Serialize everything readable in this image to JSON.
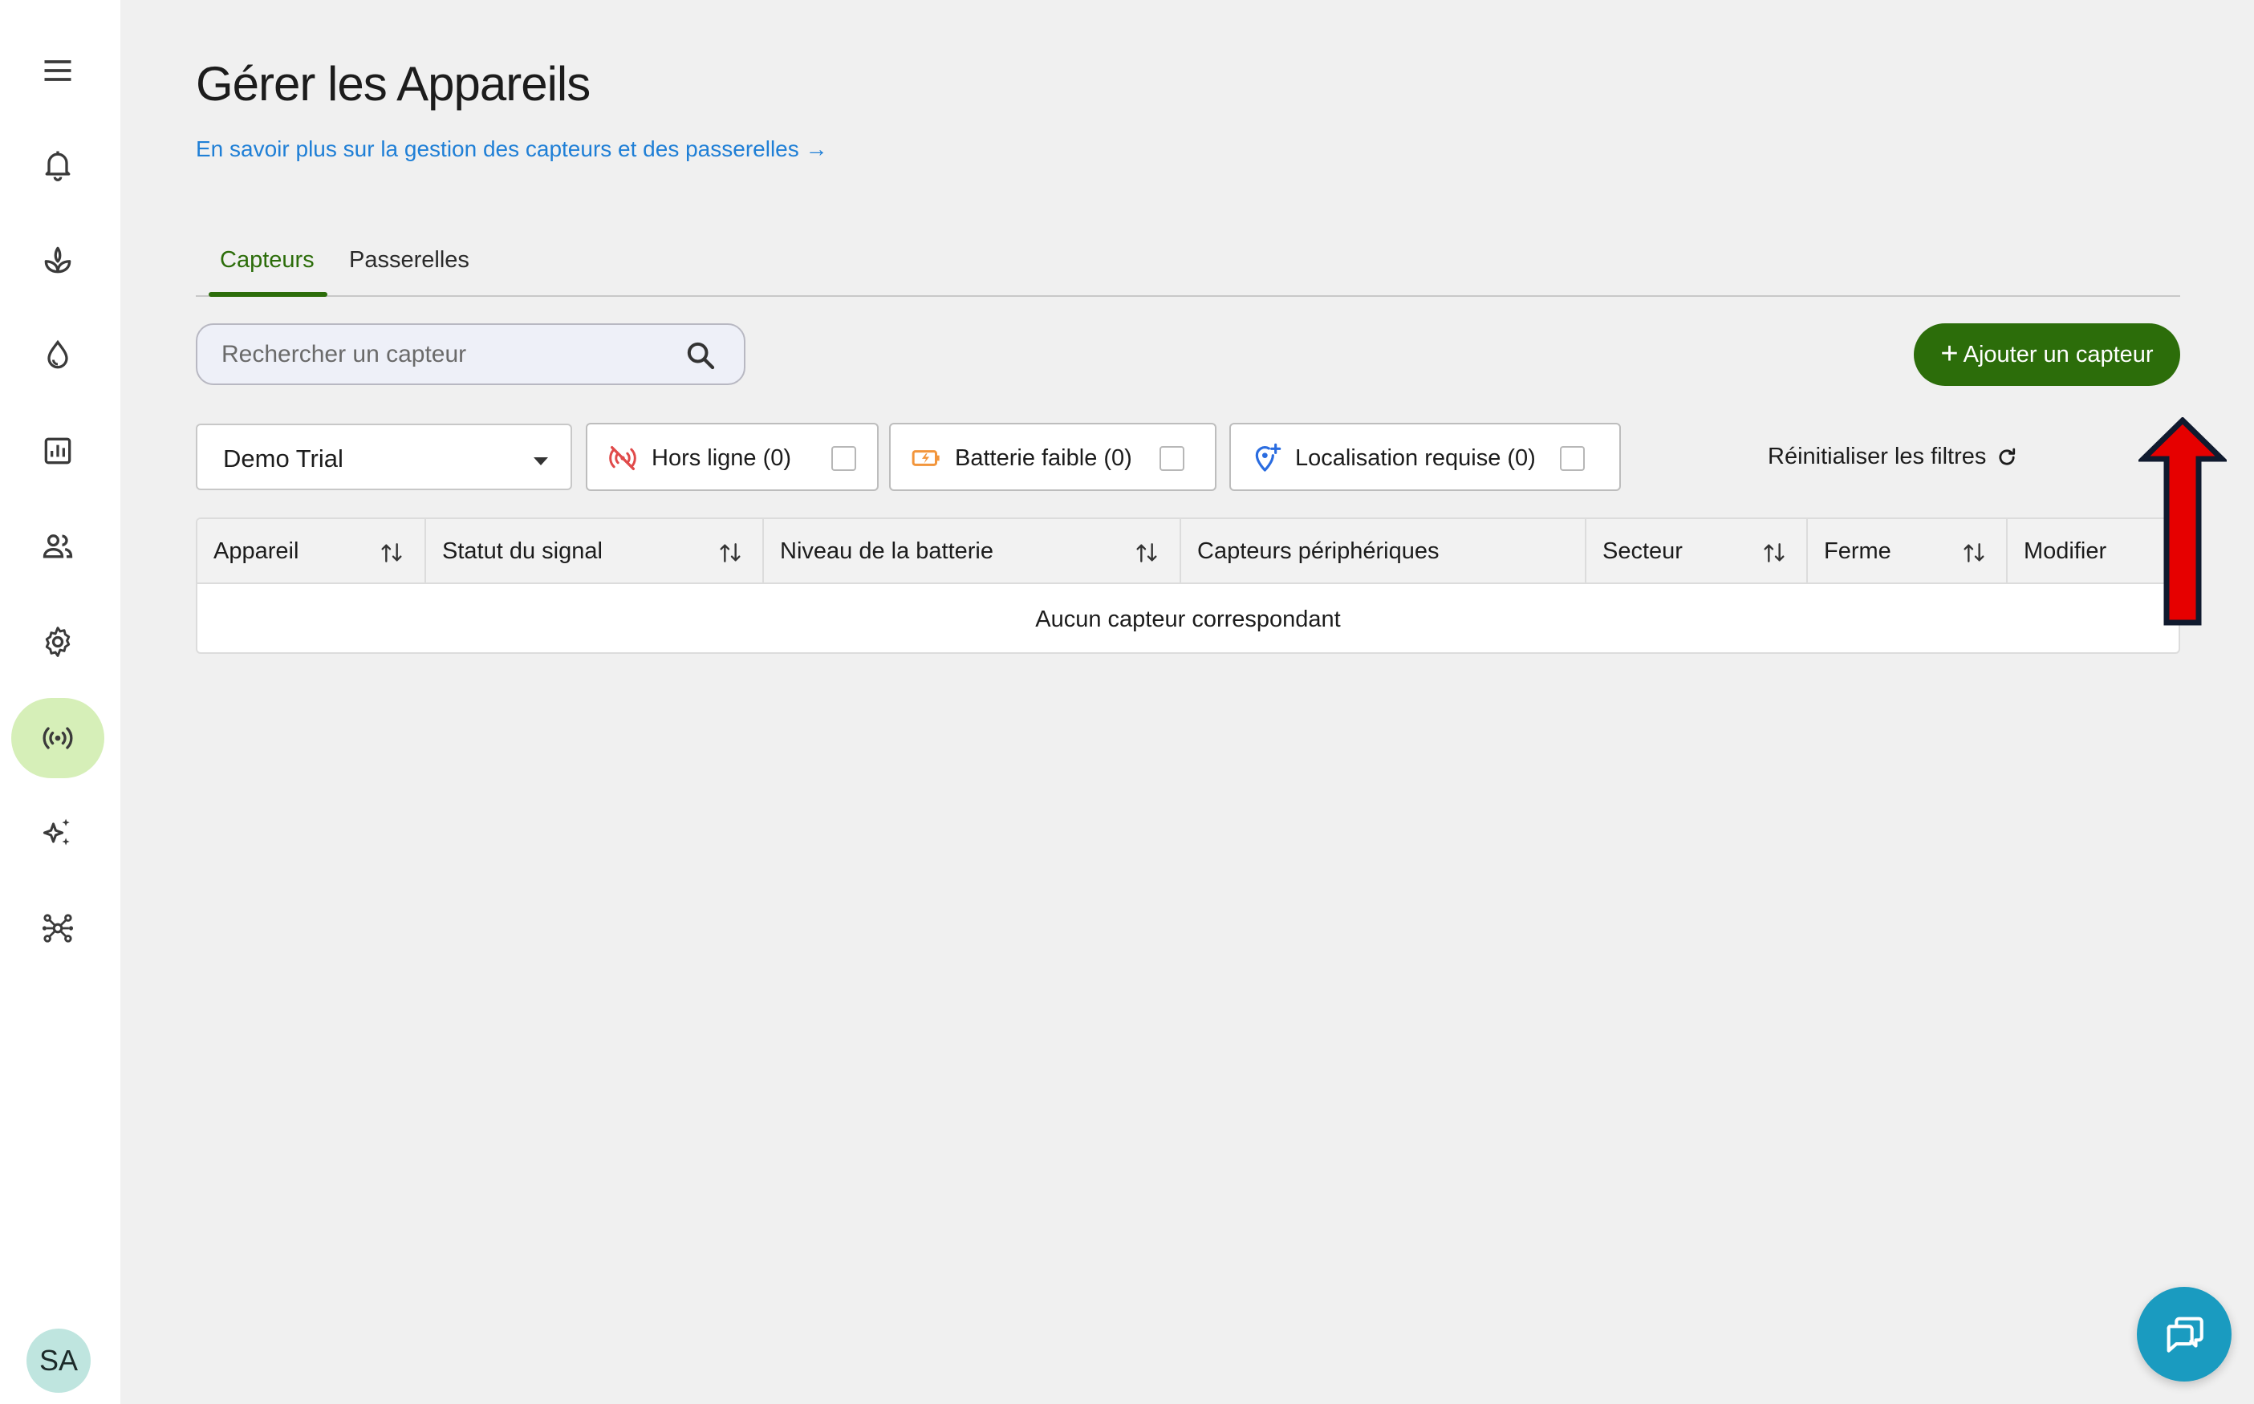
{
  "sidebar": {
    "items": [
      {
        "name": "menu-icon"
      },
      {
        "name": "bell-icon"
      },
      {
        "name": "plant-icon"
      },
      {
        "name": "water-drop-icon"
      },
      {
        "name": "report-chart-icon"
      },
      {
        "name": "users-icon"
      },
      {
        "name": "settings-gear-icon"
      },
      {
        "name": "sensor-signal-icon",
        "active": true
      },
      {
        "name": "sparkles-icon"
      },
      {
        "name": "network-hub-icon"
      }
    ],
    "avatar_initials": "SA"
  },
  "header": {
    "title": "Gérer les Appareils",
    "learn_link": "En savoir plus sur la gestion des capteurs et des passerelles →"
  },
  "tabs": [
    {
      "label": "Capteurs",
      "active": true
    },
    {
      "label": "Passerelles",
      "active": false
    }
  ],
  "search": {
    "placeholder": "Rechercher un capteur",
    "value": ""
  },
  "add_button": {
    "label": "Ajouter un capteur"
  },
  "filters": {
    "farm_select": "Demo Trial",
    "offline": {
      "label": "Hors ligne (0)",
      "checked": false
    },
    "low_battery": {
      "label": "Batterie faible (0)",
      "checked": false
    },
    "location_required": {
      "label": "Localisation requise (0)",
      "checked": false
    },
    "reset_label": "Réinitialiser les filtres"
  },
  "table": {
    "columns": [
      "Appareil",
      "Statut du signal",
      "Niveau de la batterie",
      "Capteurs périphériques",
      "Secteur",
      "Ferme",
      "Modifier"
    ],
    "empty_message": "Aucun capteur correspondant"
  },
  "colors": {
    "brand_green": "#2c6d0a",
    "active_nav_bg": "#d6efb8",
    "link_blue": "#1f7fd6",
    "chat_fab": "#1a9bc0",
    "annotation_red": "#e60000"
  }
}
